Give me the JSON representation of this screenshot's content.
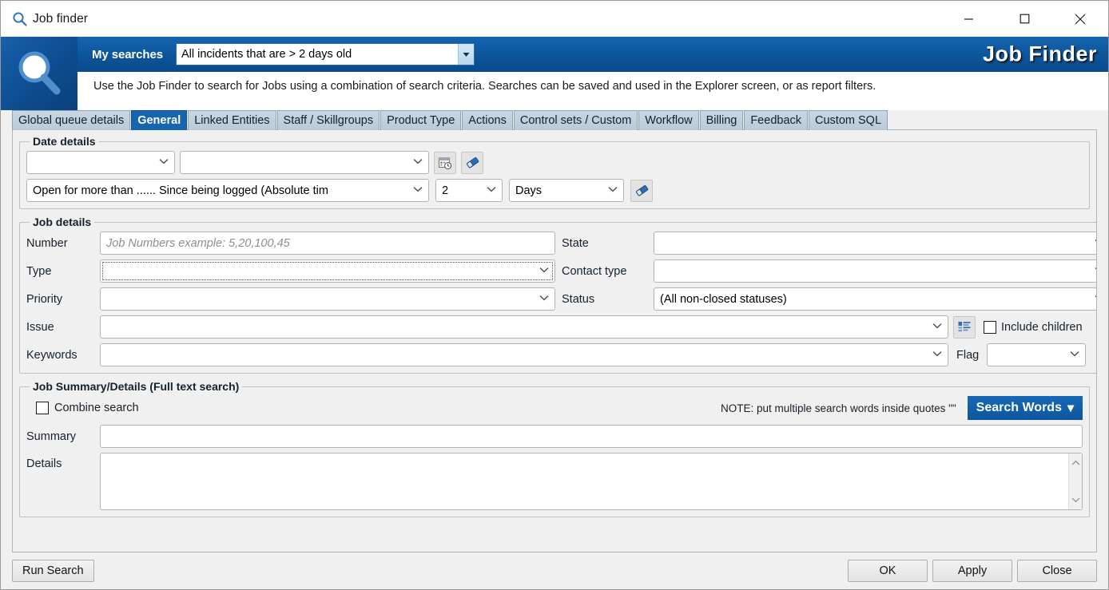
{
  "window": {
    "title": "Job finder",
    "icon": "magnifier-icon",
    "minimize_label": "Minimize",
    "maximize_label": "Maximize",
    "close_label": "Close"
  },
  "header": {
    "logo_icon": "magnifier-logo-icon",
    "my_searches_label": "My searches",
    "my_searches_value": "All incidents that are > 2 days old",
    "brand": "Job Finder",
    "description": "Use the Job Finder to search for Jobs using a combination of search criteria.  Searches can be saved and used in the Explorer screen, or as report filters.",
    "accent_color": "#0d569c",
    "brand_color": "#ffffff"
  },
  "tabs": [
    {
      "label": "Global queue details",
      "active": false
    },
    {
      "label": "General",
      "active": true
    },
    {
      "label": "Linked Entities",
      "active": false
    },
    {
      "label": "Staff / Skillgroups",
      "active": false
    },
    {
      "label": "Product Type",
      "active": false
    },
    {
      "label": "Actions",
      "active": false
    },
    {
      "label": "Control sets / Custom",
      "active": false
    },
    {
      "label": "Workflow",
      "active": false
    },
    {
      "label": "Billing",
      "active": false
    },
    {
      "label": "Feedback",
      "active": false
    },
    {
      "label": "Custom SQL",
      "active": false
    }
  ],
  "date_details": {
    "legend": "Date details",
    "field_type": "",
    "field_range": "",
    "calendar_button_icon": "calendar-clock-icon",
    "clear_button_icon": "eraser-icon",
    "condition": "Open for more than ...... Since being logged (Absolute tim",
    "amount": "2",
    "unit": "Days",
    "clear_button2_icon": "eraser-icon"
  },
  "job_details": {
    "legend": "Job details",
    "number_label": "Number",
    "number_placeholder": "Job Numbers example: 5,20,100,45",
    "number_value": "",
    "type_label": "Type",
    "type_value": "",
    "priority_label": "Priority",
    "priority_value": "",
    "issue_label": "Issue",
    "issue_value": "",
    "issue_tree_icon": "tree-list-icon",
    "include_children_label": "Include children",
    "include_children_checked": false,
    "keywords_label": "Keywords",
    "keywords_value": "",
    "state_label": "State",
    "state_value": "",
    "contact_type_label": "Contact type",
    "contact_type_value": "",
    "status_label": "Status",
    "status_value": "(All non-closed statuses)",
    "flag_label": "Flag",
    "flag_value": ""
  },
  "summary_details": {
    "legend": "Job Summary/Details (Full text search)",
    "combine_search_label": "Combine search",
    "combine_search_checked": false,
    "note": "NOTE: put multiple search words inside quotes \"\"",
    "search_words_button": "Search Words",
    "search_words_caret": "▾",
    "summary_label": "Summary",
    "summary_value": "",
    "details_label": "Details",
    "details_value": "",
    "scroll_up_icon": "chevron-up-icon",
    "scroll_down_icon": "chevron-down-icon"
  },
  "footer": {
    "run_search": "Run Search",
    "ok": "OK",
    "apply": "Apply",
    "close": "Close"
  }
}
